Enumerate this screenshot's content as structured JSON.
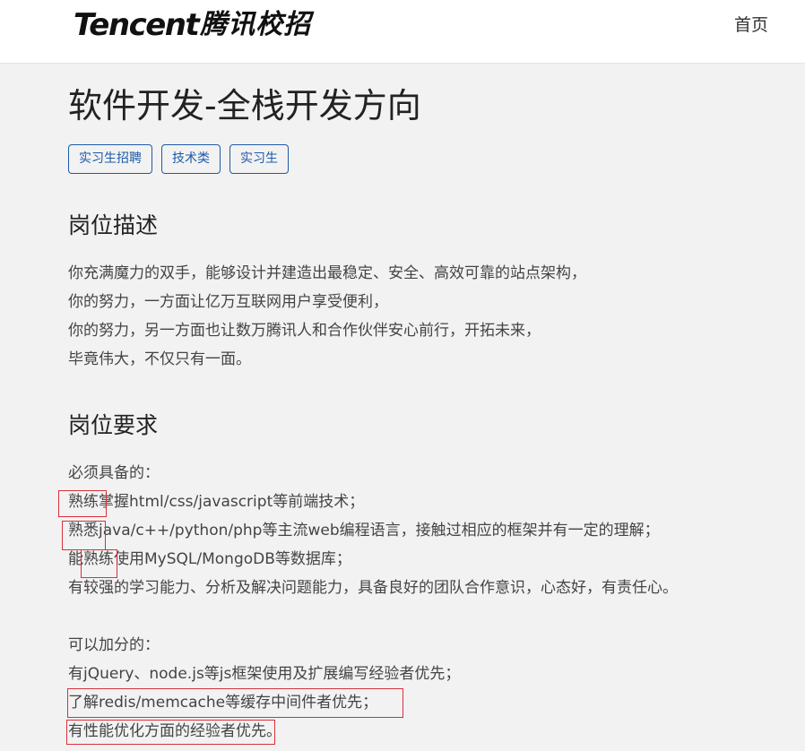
{
  "header": {
    "logo_en": "Tencent",
    "logo_cn": "腾讯校招",
    "nav_home": "首页"
  },
  "job": {
    "title": "软件开发-全栈开发方向",
    "tags": [
      "实习生招聘",
      "技术类",
      "实习生"
    ]
  },
  "description": {
    "heading": "岗位描述",
    "lines": [
      "你充满魔力的双手，能够设计并建造出最稳定、安全、高效可靠的站点架构，",
      "你的努力，一方面让亿万互联网用户享受便利，",
      "你的努力，另一方面也让数万腾讯人和合作伙伴安心前行，开拓未来，",
      "毕竟伟大，不仅只有一面。"
    ]
  },
  "requirements": {
    "heading": "岗位要求",
    "required_label": "必须具备的：",
    "required": [
      "熟练掌握html/css/javascript等前端技术；",
      "熟悉java/c++/python/php等主流web编程语言，接触过相应的框架并有一定的理解；",
      "能熟练使用MySQL/MongoDB等数据库；",
      "有较强的学习能力、分析及解决问题能力，具备良好的团队合作意识，心态好，有责任心。"
    ],
    "bonus_label": "可以加分的：",
    "bonus": [
      "有jQuery、node.js等js框架使用及扩展编写经验者优先；",
      "了解redis/memcache等缓存中间件者优先；",
      "有性能优化方面的经验者优先。"
    ]
  },
  "colors": {
    "tag_border": "#1d5aa8",
    "annotation_box": "#d9303a",
    "page_background": "#f2f2f2"
  }
}
